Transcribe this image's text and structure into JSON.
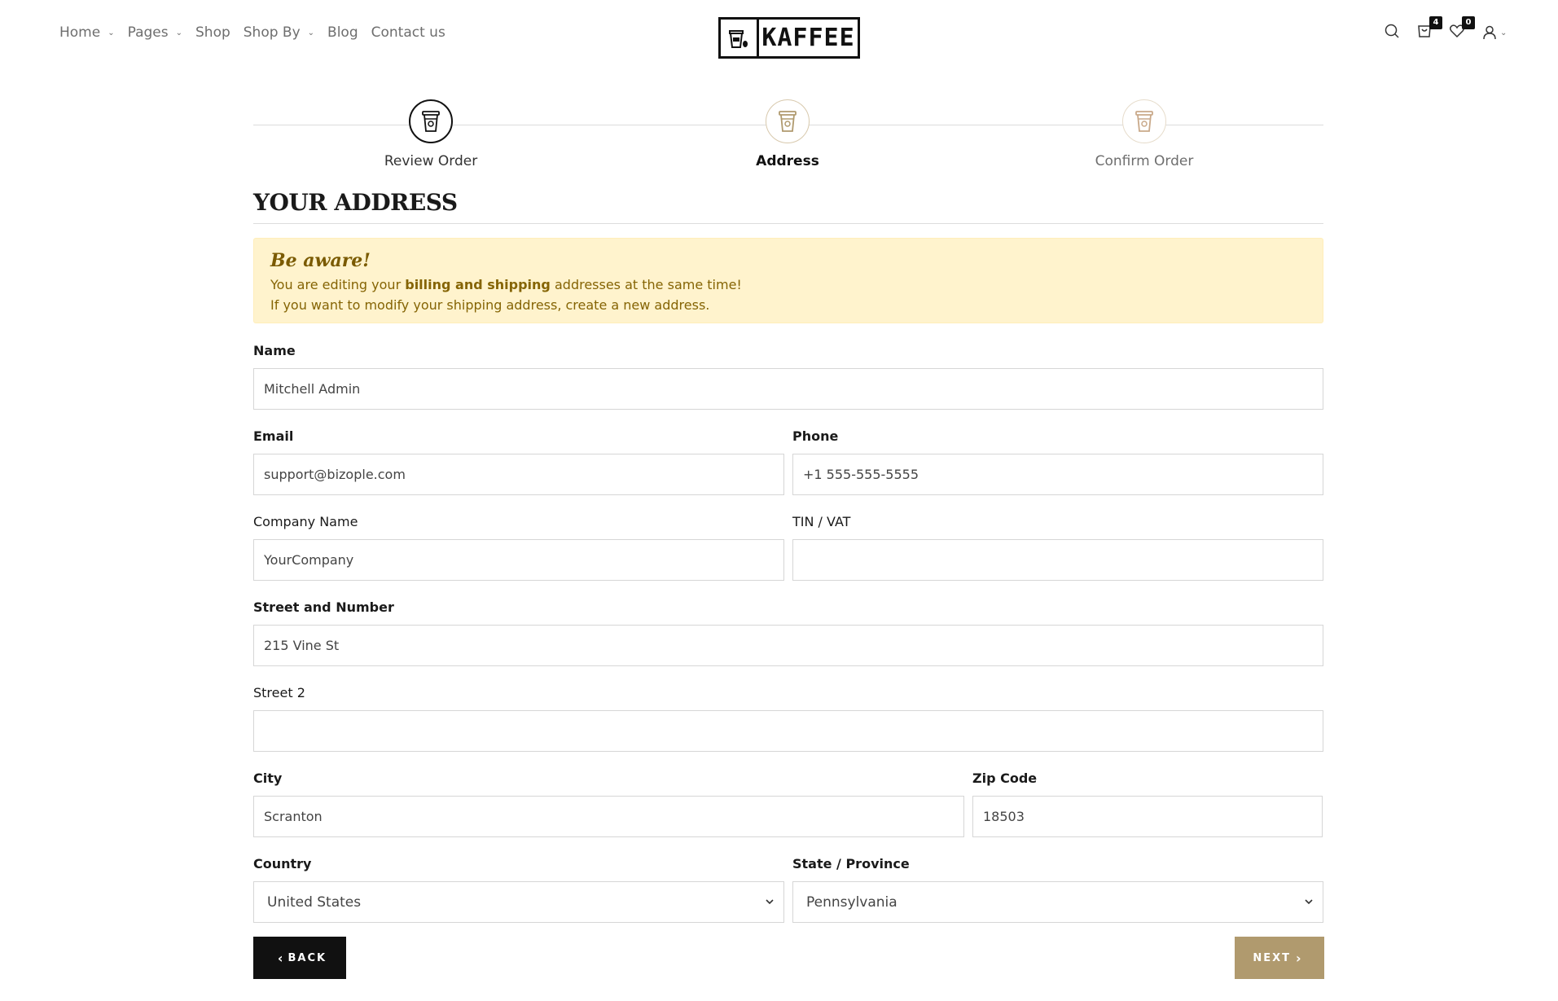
{
  "nav": {
    "items": [
      {
        "label": "Home",
        "has_dropdown": true
      },
      {
        "label": "Pages",
        "has_dropdown": true
      },
      {
        "label": "Shop",
        "has_dropdown": false
      },
      {
        "label": "Shop By",
        "has_dropdown": true
      },
      {
        "label": "Blog",
        "has_dropdown": false
      },
      {
        "label": "Contact us",
        "has_dropdown": false
      }
    ]
  },
  "logo": {
    "text": "KAFFEE",
    "icon": "coffee-cup-icon"
  },
  "header_icons": {
    "search": "search-icon",
    "cart": {
      "icon": "cart-icon",
      "count": "4"
    },
    "wishlist": {
      "icon": "heart-icon",
      "count": "0"
    },
    "account": "user-icon"
  },
  "steps": [
    {
      "label": "Review Order",
      "state": "done",
      "icon": "coffee-cup-icon"
    },
    {
      "label": "Address",
      "state": "active",
      "icon": "coffee-cup-icon"
    },
    {
      "label": "Confirm Order",
      "state": "pending",
      "icon": "coffee-cup-icon"
    }
  ],
  "section_title": "YOUR ADDRESS",
  "alert": {
    "heading": "Be aware!",
    "line1_pre": "You are editing your ",
    "line1_bold": "billing and shipping",
    "line1_post": " addresses at the same time!",
    "line2": "If you want to modify your shipping address, create a new address."
  },
  "form": {
    "name": {
      "label": "Name",
      "value": "Mitchell Admin"
    },
    "email": {
      "label": "Email",
      "value": "support@bizople.com"
    },
    "phone": {
      "label": "Phone",
      "value": "+1 555-555-5555"
    },
    "company": {
      "label": "Company Name",
      "value": "YourCompany"
    },
    "vat": {
      "label": "TIN / VAT",
      "value": ""
    },
    "street": {
      "label": "Street and Number",
      "value": "215 Vine St"
    },
    "street2": {
      "label": "Street 2",
      "value": ""
    },
    "city": {
      "label": "City",
      "value": "Scranton"
    },
    "zip": {
      "label": "Zip Code",
      "value": "18503"
    },
    "country": {
      "label": "Country",
      "value": "United States"
    },
    "state": {
      "label": "State / Province",
      "value": "Pennsylvania"
    }
  },
  "buttons": {
    "back": "BACK",
    "next": "NEXT"
  },
  "colors": {
    "accent": "#b09a6e",
    "dark": "#111111",
    "alert_bg": "#fff3cd",
    "alert_text": "#856404"
  }
}
